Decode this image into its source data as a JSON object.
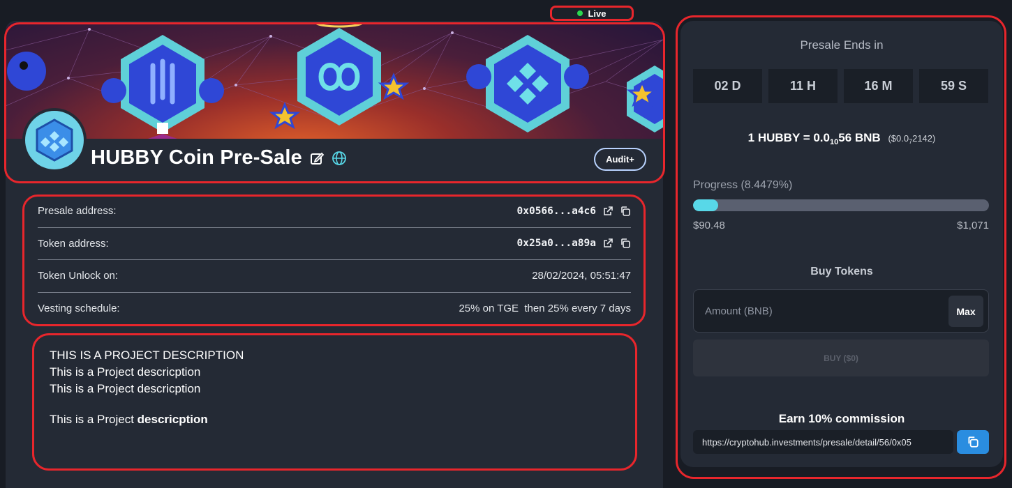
{
  "status": {
    "live_label": "Live",
    "live_color": "#2bd94f"
  },
  "project": {
    "title": "HUBBY Coin Pre-Sale",
    "audit_label": "Audit+"
  },
  "info": [
    {
      "label": "Presale address:",
      "value": "0x0566...a4c6"
    },
    {
      "label": "Token address:",
      "value": "0x25a0...a89a"
    },
    {
      "label": "Token Unlock on:",
      "value": "28/02/2024, 05:51:47"
    },
    {
      "label": "Vesting schedule:",
      "value": "25% on TGE  then 25% every 7 days"
    }
  ],
  "description": {
    "heading": "THIS IS A PROJECT DESCRIPTION",
    "line1": "This is a Project descricption",
    "line2": "This is a Project descricption",
    "line3_prefix": "This is a Project ",
    "line3_bold": "descricption"
  },
  "presale": {
    "ends_label": "Presale Ends in",
    "countdown": [
      "02 D",
      "11 H",
      "16 M",
      "59 S"
    ],
    "price_main": "1 HUBBY = 0.0",
    "price_sub": "10",
    "price_tail": "56 BNB",
    "usd_prefix": "($0.0",
    "usd_sub": "7",
    "usd_tail": "2142)",
    "progress_label": "Progress (8.4479%)",
    "progress_percent": 8.4479,
    "progress_min": "$90.48",
    "progress_max": "$1,071",
    "buy_title": "Buy Tokens",
    "amount_placeholder": "Amount (BNB)",
    "max_label": "Max",
    "buy_label": "BUY ($0)",
    "earn_title": "Earn 10% commission",
    "referral_link": "https://cryptohub.investments/presale/detail/56/0x05"
  },
  "colors": {
    "accent_cyan": "#58d8e8",
    "annotation_red": "#e8262c",
    "copy_blue": "#2a8de0"
  }
}
